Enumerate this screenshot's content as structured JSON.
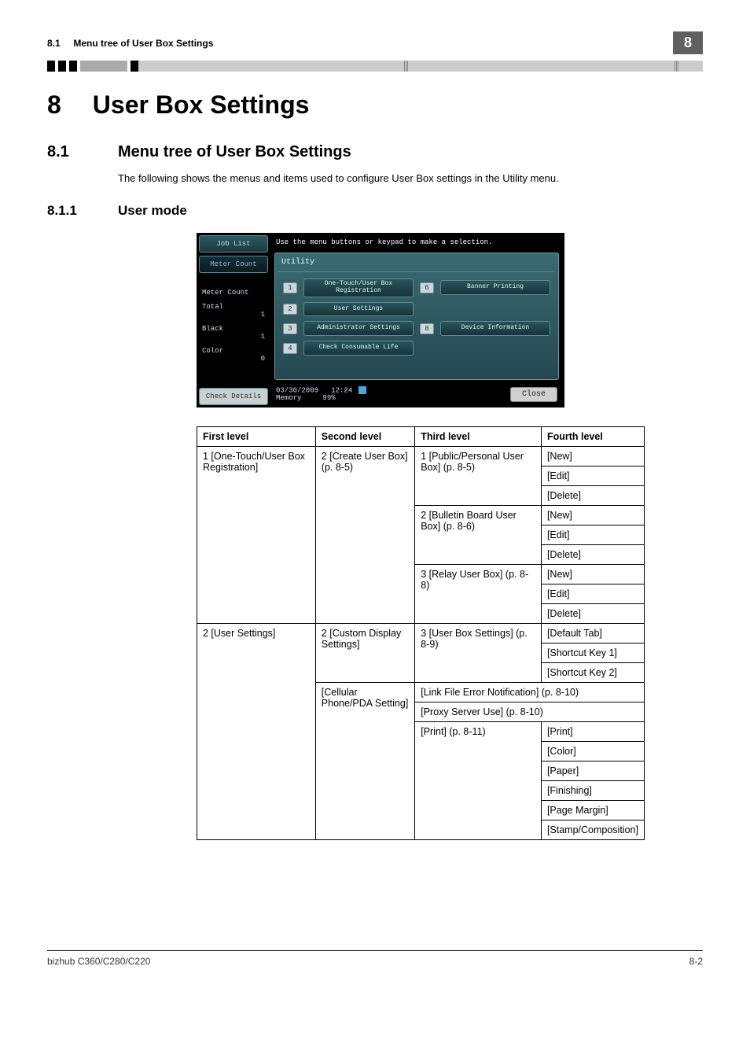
{
  "header": {
    "section_ref": "8.1",
    "section_title": "Menu tree of User Box Settings",
    "chapter_badge": "8"
  },
  "chapter": {
    "num": "8",
    "title": "User Box Settings"
  },
  "section": {
    "num": "8.1",
    "title": "Menu tree of User Box Settings"
  },
  "intro_text": "The following shows the menus and items used to configure User Box settings in the Utility menu.",
  "subsection": {
    "num": "8.1.1",
    "title": "User mode"
  },
  "utility": {
    "top_msg": "Use the menu buttons or keypad to make a selection.",
    "panel_title": "Utility",
    "left_buttons": {
      "job_list": "Job List",
      "meter_count_tab": "Meter Count",
      "meter_count_label": "Meter Count",
      "total_label": "Total",
      "total_value": "1",
      "black_label": "Black",
      "black_value": "1",
      "color_label": "Color",
      "color_value": "0",
      "check_details": "Check Details"
    },
    "menu": {
      "n1": "1",
      "b1": "One-Touch/User Box\nRegistration",
      "n2": "2",
      "b2": "User Settings",
      "n3": "3",
      "b3": "Administrator Settings",
      "n4": "4",
      "b4": "Check Consumable Life",
      "n6": "6",
      "b6": "Banner Printing",
      "n8": "8",
      "b8": "Device Information"
    },
    "bottom": {
      "date": "03/30/2009",
      "time": "12:24",
      "memory_label": "Memory",
      "memory_value": "99%",
      "close": "Close"
    }
  },
  "table": {
    "headers": {
      "c1": "First level",
      "c2": "Second level",
      "c3": "Third level",
      "c4": "Fourth level"
    },
    "r1c1": "1 [One-Touch/User Box Registration]",
    "r1c2": "2 [Create User Box] (p. 8-5)",
    "r1c3": "1 [Public/Personal User Box] (p. 8-5)",
    "r1c4a": "[New]",
    "r1c4b": "[Edit]",
    "r1c4c": "[Delete]",
    "r2c3": "2 [Bulletin Board User Box] (p. 8-6)",
    "r2c4a": "[New]",
    "r2c4b": "[Edit]",
    "r2c4c": "[Delete]",
    "r3c3": "3 [Relay User Box] (p. 8-8)",
    "r3c4a": "[New]",
    "r3c4b": "[Edit]",
    "r3c4c": "[Delete]",
    "r4c1": "2 [User Settings]",
    "r4c2": "2 [Custom Display Settings]",
    "r4c3": "3 [User Box Settings] (p. 8-9)",
    "r4c4a": "[Default Tab]",
    "r4c4b": "[Shortcut Key 1]",
    "r4c4c": "[Shortcut Key 2]",
    "r5c2": "[Cellular Phone/PDA Setting]",
    "r5c3a": "[Link File Error Notification] (p. 8-10)",
    "r5c3b": "[Proxy Server Use] (p. 8-10)",
    "r5c3c": "[Print] (p. 8-11)",
    "r5c4a": "[Print]",
    "r5c4b": "[Color]",
    "r5c4c": "[Paper]",
    "r5c4d": "[Finishing]",
    "r5c4e": "[Page Margin]",
    "r5c4f": "[Stamp/Composition]"
  },
  "footer": {
    "left": "bizhub C360/C280/C220",
    "right": "8-2"
  }
}
